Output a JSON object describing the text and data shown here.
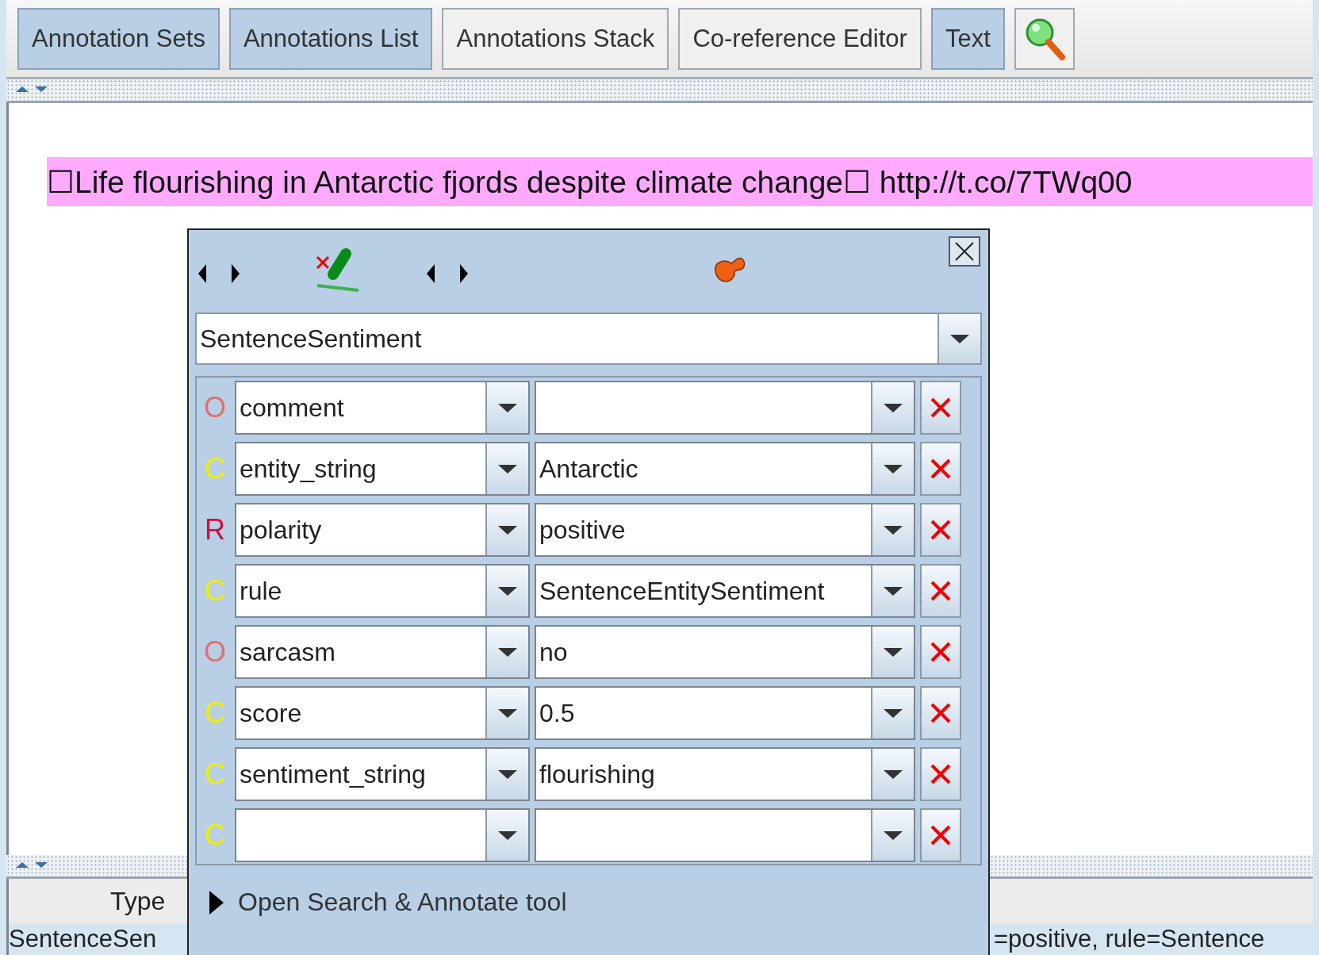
{
  "toolbar": {
    "buttons": [
      {
        "label": "Annotation Sets",
        "selected": true
      },
      {
        "label": "Annotations List",
        "selected": true
      },
      {
        "label": "Annotations Stack",
        "selected": false
      },
      {
        "label": "Co-reference Editor",
        "selected": false
      },
      {
        "label": "Text",
        "selected": true
      }
    ]
  },
  "document": {
    "text": "☐Life flourishing in Antarctic fjords despite climate change☐ http://t.co/7TWq00"
  },
  "annotation_table": {
    "columns": [
      "Type"
    ],
    "row": {
      "type": "SentenceSen",
      "features": "=positive, rule=Sentence"
    }
  },
  "editor": {
    "annotation_type": "SentenceSentiment",
    "features": [
      {
        "marker": "O",
        "color": "#e07070",
        "name": "comment"
      },
      {
        "marker": "C",
        "color": "#f0f000",
        "name": "entity_string",
        "value": "Antarctic"
      },
      {
        "marker": "R",
        "color": "#d0103a",
        "name": "polarity",
        "value": "positive"
      },
      {
        "marker": "C",
        "color": "#f0f000",
        "name": "rule",
        "value": "SentenceEntitySentiment"
      },
      {
        "marker": "O",
        "color": "#e07070",
        "name": "sarcasm",
        "value": "no"
      },
      {
        "marker": "C",
        "color": "#f0f000",
        "name": "score",
        "value": "0.5"
      },
      {
        "marker": "C",
        "color": "#f0f000",
        "name": "sentiment_string",
        "value": "flourishing"
      },
      {
        "marker": "C",
        "color": "#f0f000"
      }
    ],
    "search_toggle": "Open Search & Annotate tool"
  }
}
